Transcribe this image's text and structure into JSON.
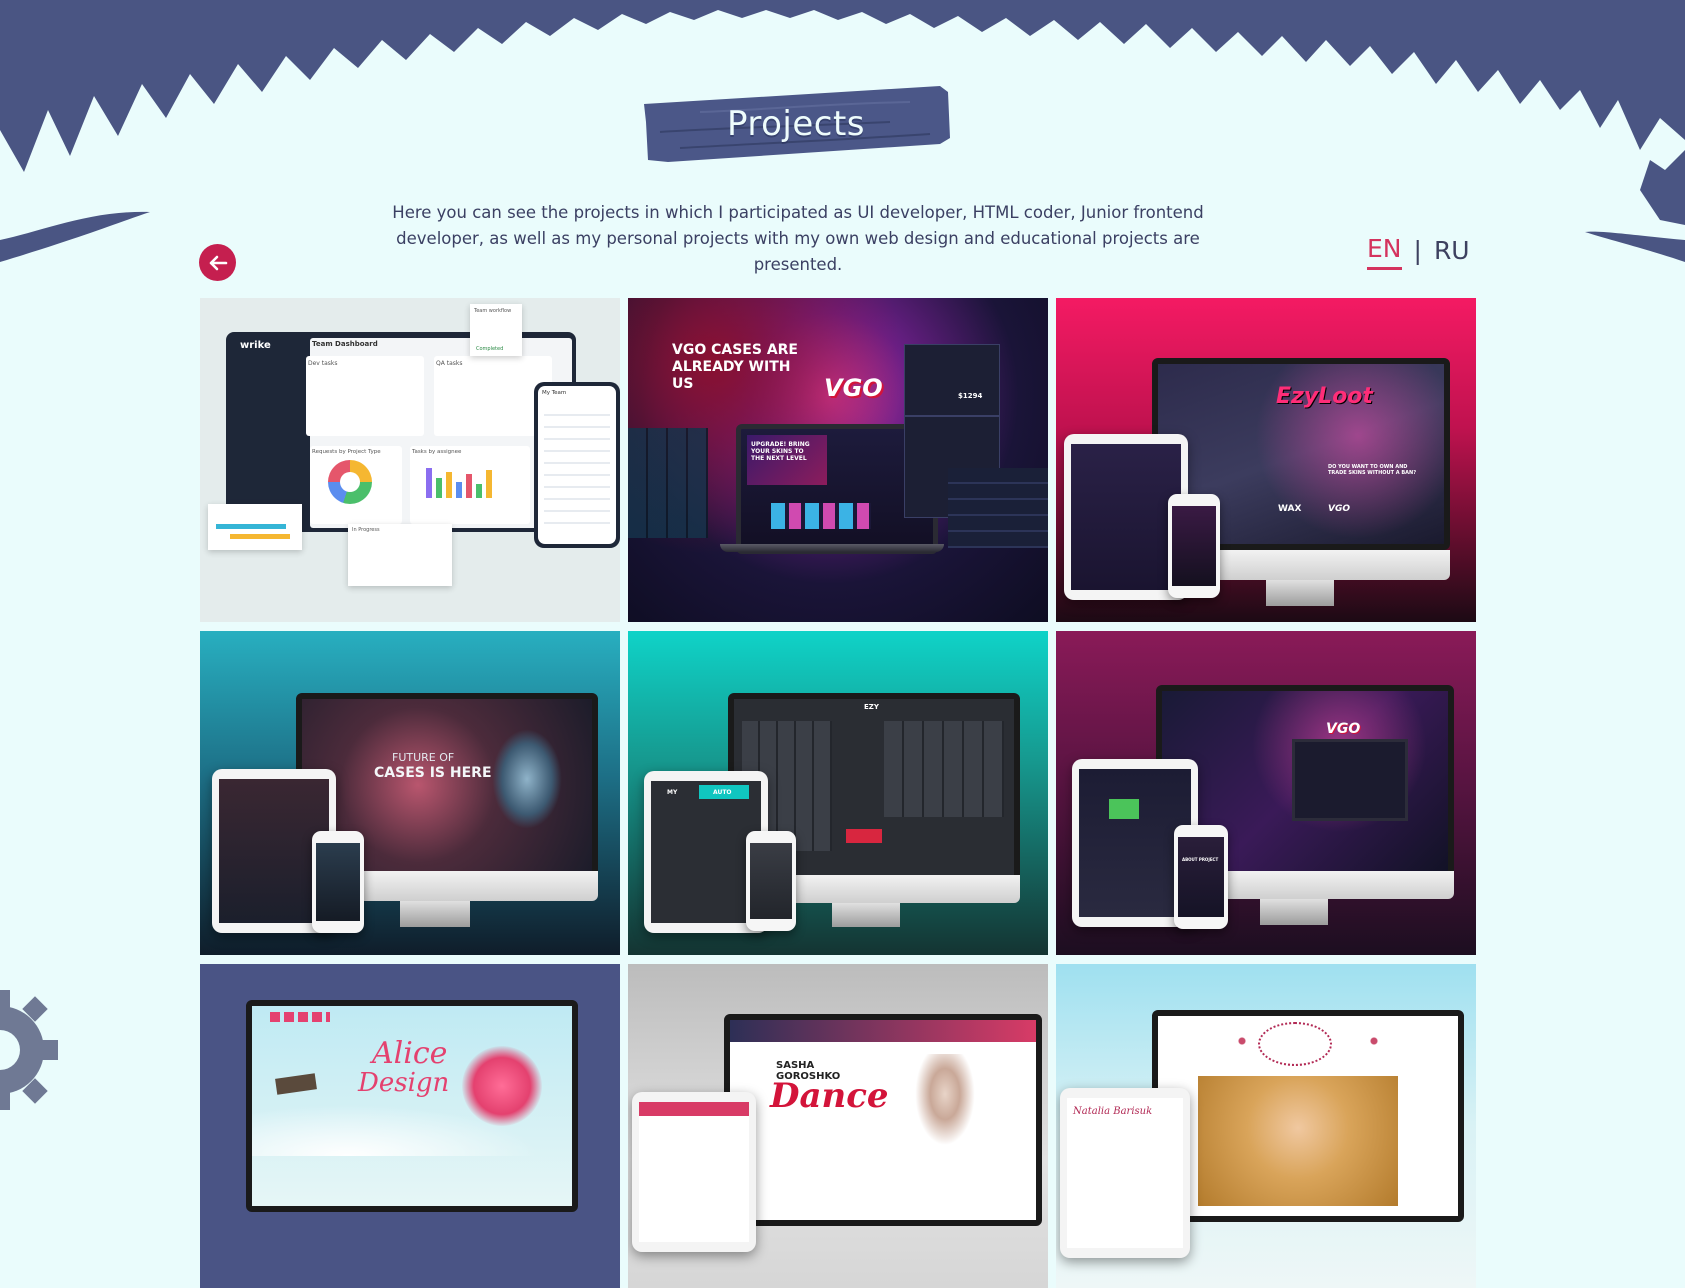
{
  "page": {
    "title": "Projects",
    "intro": "Here you can see the projects in which I participated as UI developer, HTML coder, Junior frontend developer, as well as my personal projects with my own web design and educational projects are presented."
  },
  "nav": {
    "back_icon": "arrow-left-icon"
  },
  "languages": {
    "en": "EN",
    "separator": "|",
    "ru": "RU",
    "active": "en"
  },
  "colors": {
    "background": "#eafcfc",
    "foliage": "#4a5583",
    "accent": "#c51f4f",
    "plank": "#4b5788"
  },
  "projects": [
    {
      "id": "wrike",
      "screen": {
        "brand": "wrike",
        "heading": "Team Dashboard",
        "col1": "Dev tasks",
        "col2": "QA tasks",
        "chart1": "Requests by Project Type",
        "chart2": "Tasks by assignee",
        "side": "Team workflow",
        "team": "My Team",
        "badge": "Completed",
        "badge2": "In Progress"
      }
    },
    {
      "id": "vgo-cases",
      "screen": {
        "headline": "VGO CASES ARE ALREADY WITH US",
        "logo": "VGO",
        "promo": "UPGRADE! BRING YOUR SKINS TO THE NEXT LEVEL",
        "price": "$1294"
      }
    },
    {
      "id": "easyloot",
      "screen": {
        "logo": "EzyLoot",
        "question": "DO YOU WANT TO OWN AND TRADE SKINS WITHOUT A BAN?",
        "partner1": "WAX",
        "partner2": "VGO"
      }
    },
    {
      "id": "future-cases",
      "screen": {
        "line1": "FUTURE OF",
        "line2": "CASES IS HERE"
      }
    },
    {
      "id": "ezy-market",
      "screen": {
        "logo": "EZY",
        "tab1": "MY",
        "tab2": "AUTO"
      }
    },
    {
      "id": "vgo-project",
      "screen": {
        "logo": "VGO",
        "tag": "ABOUT PROJECT"
      }
    },
    {
      "id": "alice-design",
      "screen": {
        "logo_line1": "Alice",
        "logo_line2": "Design"
      }
    },
    {
      "id": "sasha-goroshko",
      "screen": {
        "name": "SASHA GOROSHKO",
        "word": "Dance"
      }
    },
    {
      "id": "natalia-barisuk",
      "screen": {
        "signature": "Natalia Barisuk"
      }
    }
  ]
}
